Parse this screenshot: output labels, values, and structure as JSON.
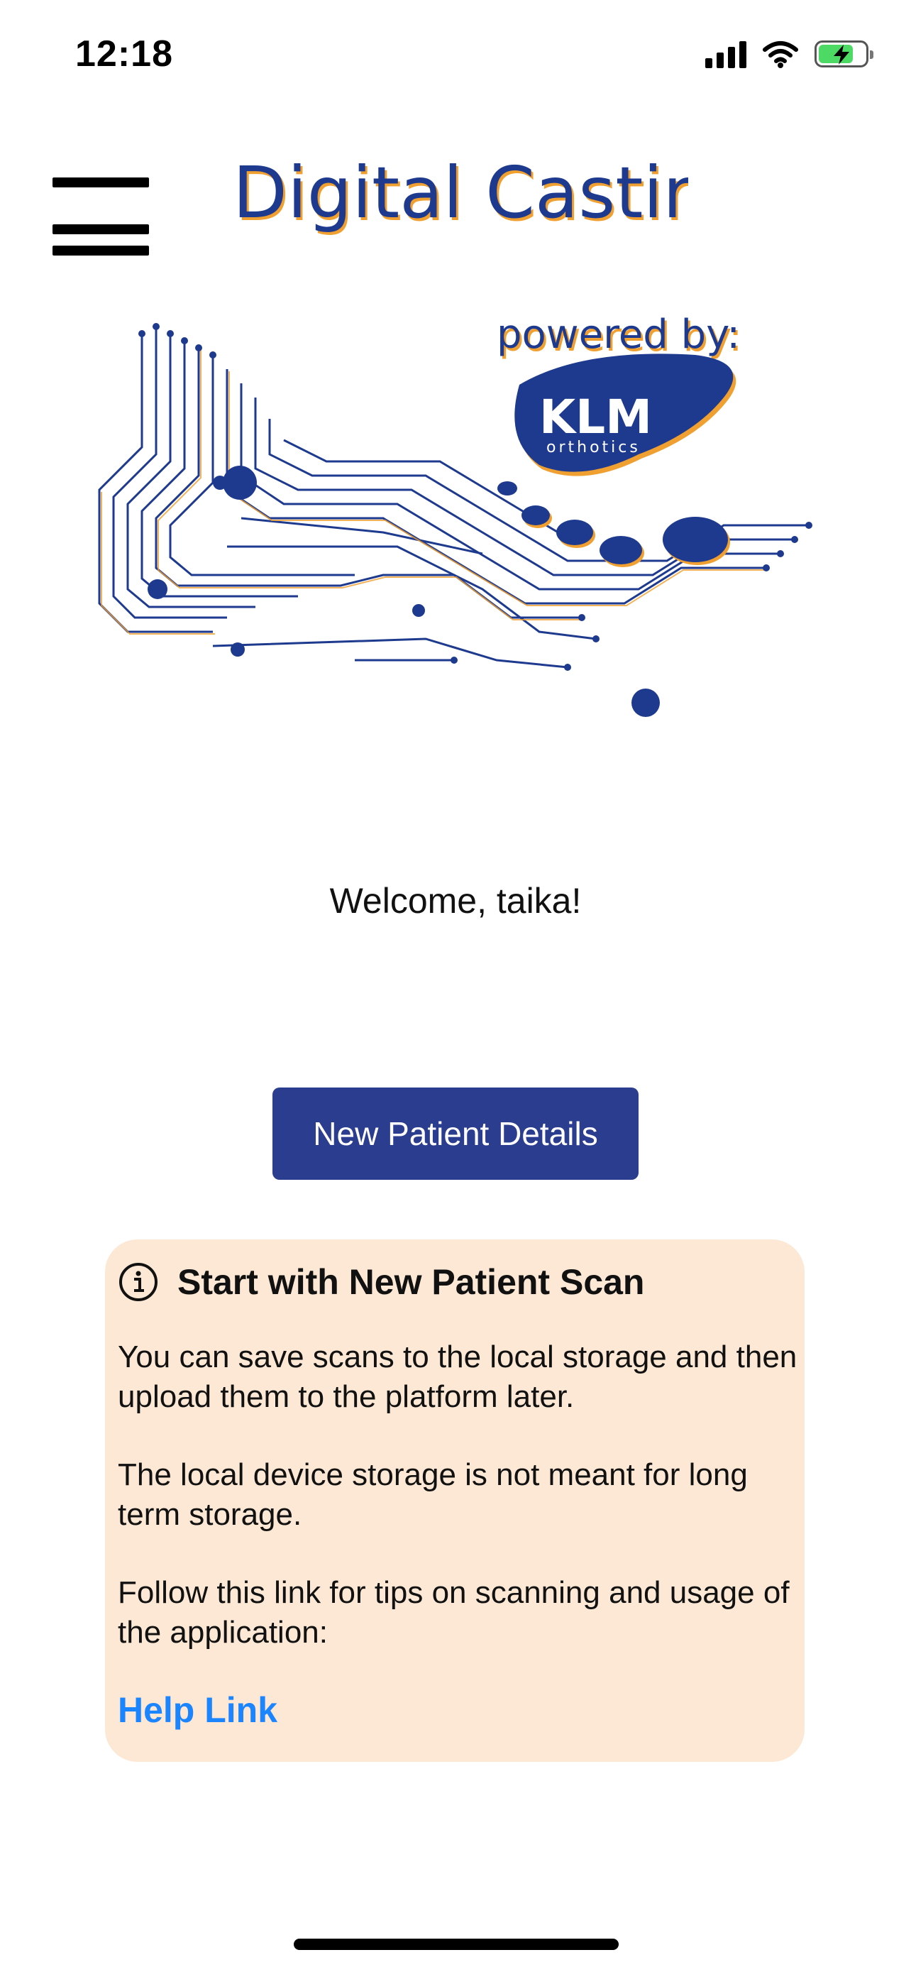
{
  "status_bar": {
    "time": "12:18",
    "icons": [
      "signal-icon",
      "wifi-icon",
      "battery-charging-icon"
    ],
    "battery_level": 0.75
  },
  "header": {
    "menu_icon": "hamburger-menu-icon",
    "app_title": "Digital Casting"
  },
  "hero": {
    "tagline": "powered by:",
    "brand": "KLM",
    "brand_sub": "orthotics"
  },
  "welcome": {
    "text": "Welcome, taika!"
  },
  "actions": {
    "new_patient_label": "New Patient Details"
  },
  "info": {
    "icon": "info-icon",
    "title": "Start with New Patient Scan",
    "para1": "You can save scans to the local storage and then upload them to the platform later.",
    "para2": "The local device storage is not meant for long term storage.",
    "para3": "Follow this link for tips on scanning and usage of the application:",
    "link": "Help Link"
  },
  "colors": {
    "primary": "#2b3d8e",
    "logo_blue": "#1e3a8f",
    "logo_orange": "#f0a030",
    "card_bg": "#fce8d4",
    "link": "#1b84ff",
    "battery": "#4cd964"
  }
}
